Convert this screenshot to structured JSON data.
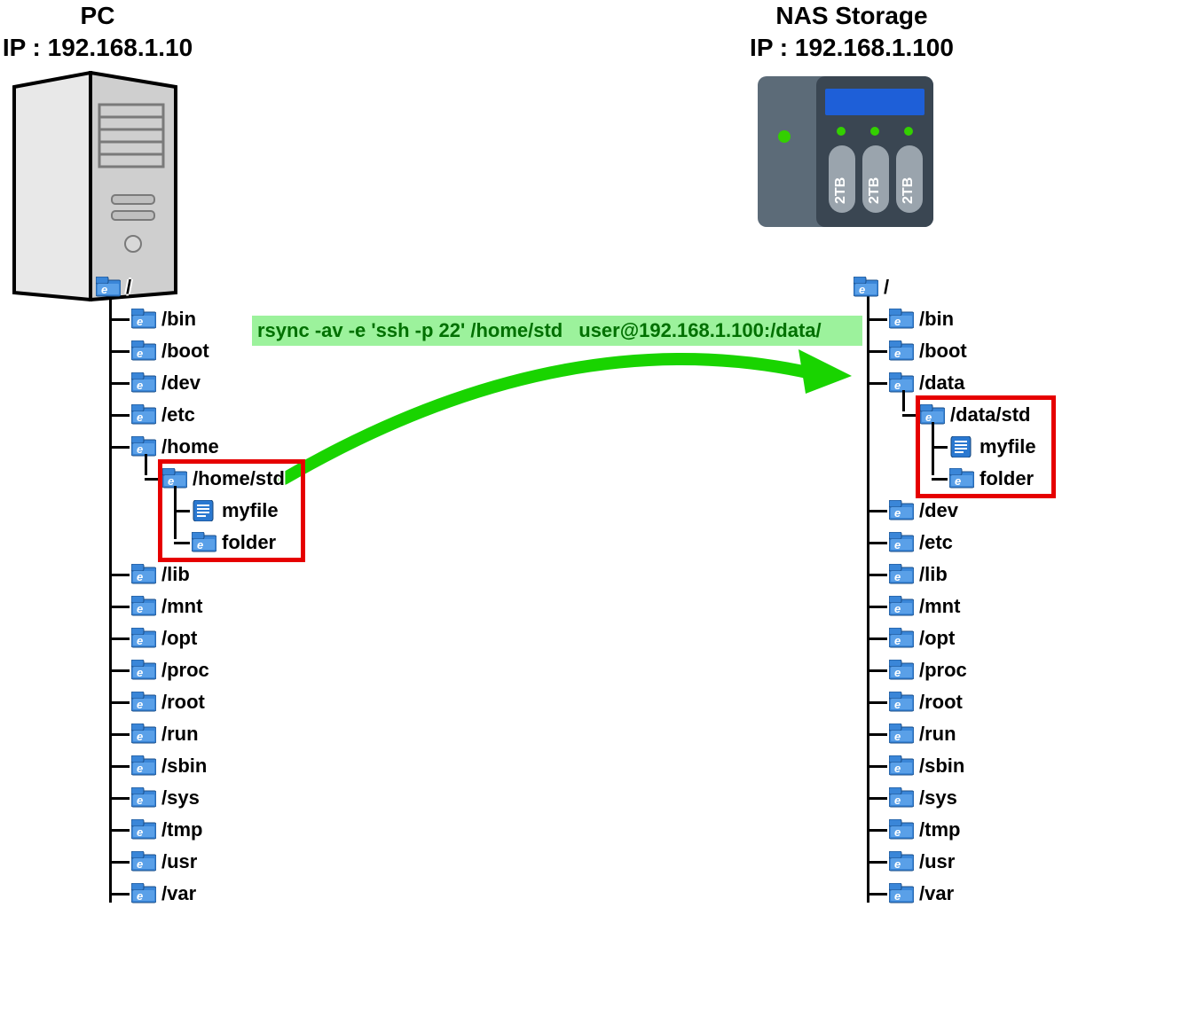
{
  "pc": {
    "title": "PC",
    "ip_line": "IP : 192.168.1.10",
    "tree": {
      "root": "/",
      "dirs_top": [
        "/bin",
        "/boot",
        "/dev",
        "/etc",
        "/home"
      ],
      "home_child": "/home/std",
      "std_children": [
        "myfile",
        "folder"
      ],
      "dirs_bottom": [
        "/lib",
        "/mnt",
        "/opt",
        "/proc",
        "/root",
        "/run",
        "/sbin",
        "/sys",
        "/tmp",
        "/usr",
        "/var"
      ]
    }
  },
  "nas": {
    "title": "NAS Storage",
    "ip_line": "IP : 192.168.1.100",
    "drive_label": "2TB",
    "drive_count": 3,
    "tree": {
      "root": "/",
      "dirs_top": [
        "/bin",
        "/boot",
        "/data"
      ],
      "data_child": "/data/std",
      "std_children": [
        "myfile",
        "folder"
      ],
      "dirs_bottom": [
        "/dev",
        "/etc",
        "/lib",
        "/mnt",
        "/opt",
        "/proc",
        "/root",
        "/run",
        "/sbin",
        "/sys",
        "/tmp",
        "/usr",
        "/var"
      ]
    }
  },
  "command": {
    "part1": "rsync -av -e 'ssh -p 22' /home/std",
    "part2": "user@192.168.1.100:/data/"
  },
  "icons": {
    "folder": "folder-icon",
    "file": "file-icon"
  }
}
